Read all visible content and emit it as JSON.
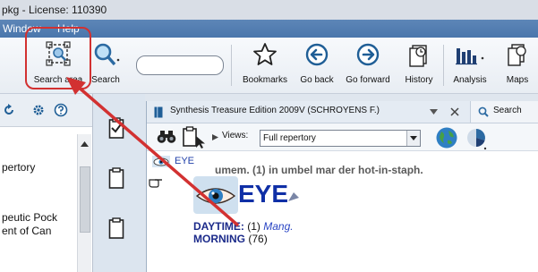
{
  "window": {
    "title": "pkg - License: 110390"
  },
  "menubar": {
    "items": [
      "Window",
      "Help"
    ]
  },
  "toolbar": {
    "search_area_label": "Search area",
    "search_label": "Search",
    "search_box_value": "",
    "buttons": [
      {
        "label": "Bookmarks",
        "icon": "star-icon"
      },
      {
        "label": "Go back",
        "icon": "arrow-left-circle-icon"
      },
      {
        "label": "Go forward",
        "icon": "arrow-right-circle-icon"
      },
      {
        "label": "History",
        "icon": "history-icon"
      },
      {
        "label": "Analysis",
        "icon": "bar-chart-icon"
      },
      {
        "label": "Maps",
        "icon": "maps-icon"
      }
    ]
  },
  "left_panel": {
    "items": [
      "pertory",
      "peutic Pock",
      "ent of Can"
    ]
  },
  "inner_window": {
    "tab_title": "Synthesis Treasure Edition 2009V (SCHROYENS F.)",
    "search_tab_label": "Search",
    "views_label": "Views:",
    "views_value": "Full repertory",
    "breadcrumb": "EYE",
    "chapter_title": "EYE",
    "prev_entry_text": "umem. (1) in umbel mar der hot-in-staph.",
    "rubrics": [
      {
        "name": "DAYTIME:",
        "count": "(1)",
        "remedy": "Mang."
      },
      {
        "name": "MORNING",
        "count": "(76)",
        "remedy": ""
      }
    ]
  },
  "annotation": {
    "color": "#d23131"
  }
}
